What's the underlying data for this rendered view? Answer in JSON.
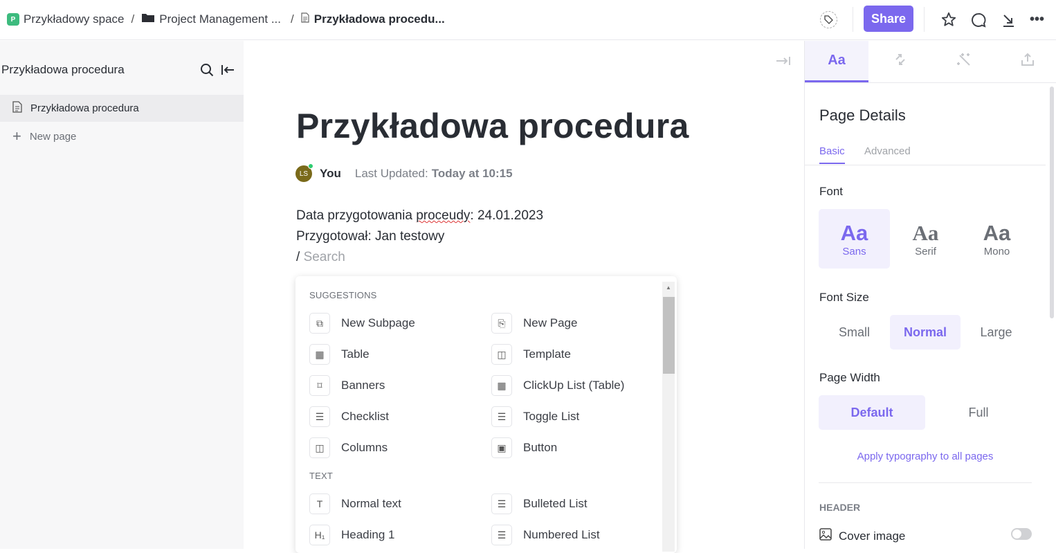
{
  "breadcrumb": {
    "space_badge": "P",
    "space": "Przykładowy space",
    "folder": "Project Management ...",
    "page": "Przykładowa procedu...",
    "separator": "/"
  },
  "topbar": {
    "share_label": "Share",
    "icons": [
      "tag-icon",
      "star-icon",
      "comment-icon",
      "collapse-icon",
      "more-icon"
    ]
  },
  "sidebar": {
    "title": "Przykładowa procedura",
    "items": [
      {
        "label": "Przykładowa procedura",
        "active": true
      }
    ],
    "new_page": "New page"
  },
  "doc": {
    "title": "Przykładowa procedura",
    "author_initials": "LS",
    "author": "You",
    "last_updated_label": "Last Updated:",
    "last_updated": "Today at 10:15",
    "lines": {
      "l1_a": "Data przygotowania ",
      "l1_b": "proceudy",
      "l1_c": ": 24.01.2023",
      "l2": "Przygotował: Jan testowy"
    },
    "slash": "/",
    "search_placeholder": "Search"
  },
  "menu": {
    "suggestions_header": "SUGGESTIONS",
    "text_header": "TEXT",
    "suggestions": [
      {
        "label": "New Subpage",
        "icon": "subpage-icon"
      },
      {
        "label": "New Page",
        "icon": "new-page-icon"
      },
      {
        "label": "Table",
        "icon": "table-icon"
      },
      {
        "label": "Template",
        "icon": "template-icon"
      },
      {
        "label": "Banners",
        "icon": "bookmark-icon"
      },
      {
        "label": "ClickUp List (Table)",
        "icon": "list-table-icon"
      },
      {
        "label": "Checklist",
        "icon": "checklist-icon"
      },
      {
        "label": "Toggle List",
        "icon": "toggle-list-icon"
      },
      {
        "label": "Columns",
        "icon": "columns-icon"
      },
      {
        "label": "Button",
        "icon": "button-icon"
      }
    ],
    "text": [
      {
        "label": "Normal text",
        "icon": "text-icon"
      },
      {
        "label": "Bulleted List",
        "icon": "bulleted-list-icon"
      },
      {
        "label": "Heading 1",
        "icon": "heading-icon"
      },
      {
        "label": "Numbered List",
        "icon": "numbered-list-icon"
      }
    ]
  },
  "panel": {
    "tab_active": "Aa",
    "title": "Page Details",
    "subtabs": {
      "basic": "Basic",
      "advanced": "Advanced"
    },
    "font_label": "Font",
    "fonts": [
      {
        "glyph": "Aa",
        "label": "Sans",
        "selected": true
      },
      {
        "glyph": "Aa",
        "label": "Serif"
      },
      {
        "glyph": "Aa",
        "label": "Mono"
      }
    ],
    "font_size_label": "Font Size",
    "sizes": {
      "small": "Small",
      "normal": "Normal",
      "large": "Large",
      "selected": "Normal"
    },
    "width_label": "Page Width",
    "widths": {
      "default": "Default",
      "full": "Full",
      "selected": "Default"
    },
    "apply_link": "Apply typography to all pages",
    "header_section": "HEADER",
    "cover_image": "Cover image",
    "cover_image_on": false
  },
  "colors": {
    "accent": "#7b68ee",
    "space_badge": "#3dbb7e"
  }
}
